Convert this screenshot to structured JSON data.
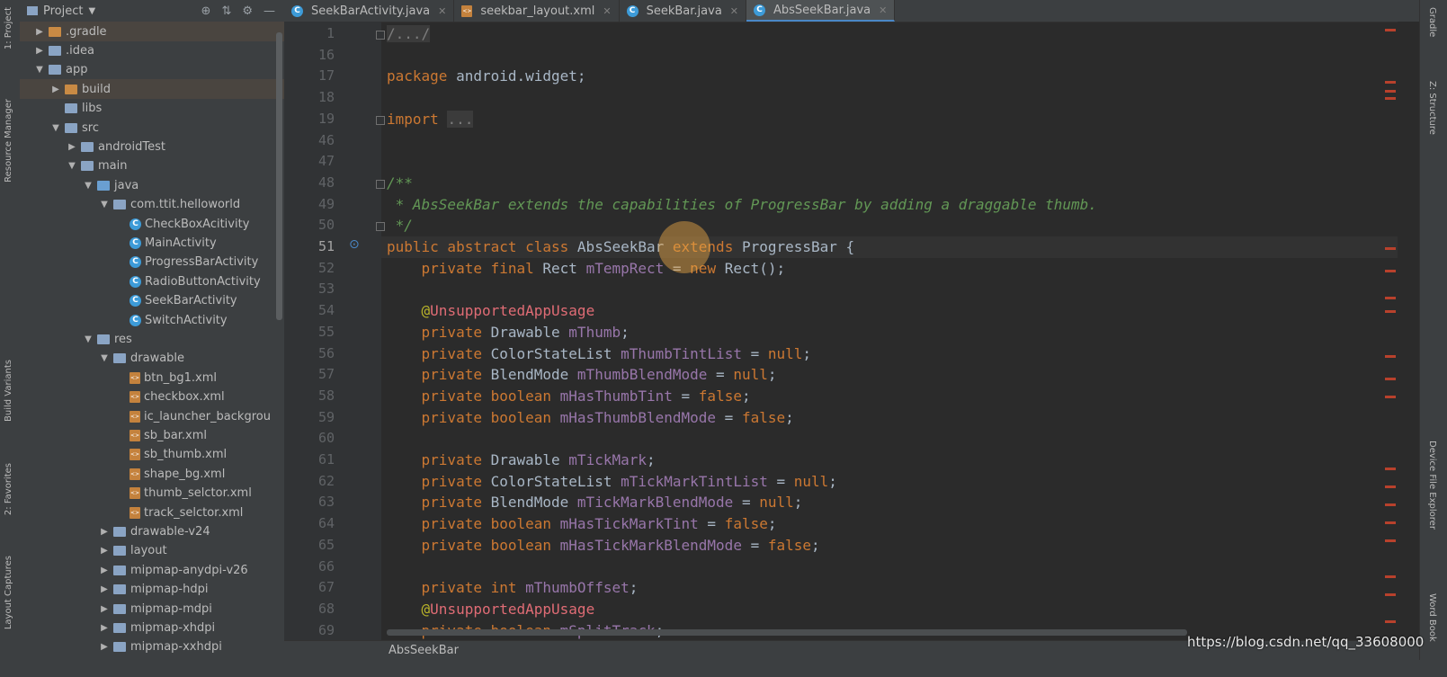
{
  "left_stripe": {
    "tabs": [
      "1: Project",
      "Resource Manager",
      "Build Variants",
      "2: Favorites",
      "Layout Captures"
    ]
  },
  "project_panel": {
    "title": "Project",
    "icons": [
      "target-icon",
      "collapse-icon",
      "gear-icon",
      "minimize-icon"
    ],
    "tree": [
      {
        "label": ".gradle",
        "depth": 1,
        "arrow": "▶",
        "icon": "folder-orange",
        "highlight": true
      },
      {
        "label": ".idea",
        "depth": 1,
        "arrow": "▶",
        "icon": "folder"
      },
      {
        "label": "app",
        "depth": 1,
        "arrow": "▼",
        "icon": "folder"
      },
      {
        "label": "build",
        "depth": 2,
        "arrow": "▶",
        "icon": "folder-orange",
        "highlight": true
      },
      {
        "label": "libs",
        "depth": 2,
        "arrow": "",
        "icon": "folder"
      },
      {
        "label": "src",
        "depth": 2,
        "arrow": "▼",
        "icon": "folder"
      },
      {
        "label": "androidTest",
        "depth": 3,
        "arrow": "▶",
        "icon": "folder"
      },
      {
        "label": "main",
        "depth": 3,
        "arrow": "▼",
        "icon": "folder"
      },
      {
        "label": "java",
        "depth": 4,
        "arrow": "▼",
        "icon": "folder-blue"
      },
      {
        "label": "com.ttit.helloworld",
        "depth": 5,
        "arrow": "▼",
        "icon": "folder"
      },
      {
        "label": "CheckBoxAcitivity",
        "depth": 6,
        "arrow": "",
        "icon": "class"
      },
      {
        "label": "MainActivity",
        "depth": 6,
        "arrow": "",
        "icon": "class"
      },
      {
        "label": "ProgressBarActivity",
        "depth": 6,
        "arrow": "",
        "icon": "class"
      },
      {
        "label": "RadioButtonActivity",
        "depth": 6,
        "arrow": "",
        "icon": "class"
      },
      {
        "label": "SeekBarActivity",
        "depth": 6,
        "arrow": "",
        "icon": "class"
      },
      {
        "label": "SwitchActivity",
        "depth": 6,
        "arrow": "",
        "icon": "class"
      },
      {
        "label": "res",
        "depth": 4,
        "arrow": "▼",
        "icon": "folder"
      },
      {
        "label": "drawable",
        "depth": 5,
        "arrow": "▼",
        "icon": "folder"
      },
      {
        "label": "btn_bg1.xml",
        "depth": 6,
        "arrow": "",
        "icon": "xml"
      },
      {
        "label": "checkbox.xml",
        "depth": 6,
        "arrow": "",
        "icon": "xml"
      },
      {
        "label": "ic_launcher_backgrou",
        "depth": 6,
        "arrow": "",
        "icon": "xml"
      },
      {
        "label": "sb_bar.xml",
        "depth": 6,
        "arrow": "",
        "icon": "xml"
      },
      {
        "label": "sb_thumb.xml",
        "depth": 6,
        "arrow": "",
        "icon": "xml"
      },
      {
        "label": "shape_bg.xml",
        "depth": 6,
        "arrow": "",
        "icon": "xml"
      },
      {
        "label": "thumb_selctor.xml",
        "depth": 6,
        "arrow": "",
        "icon": "xml"
      },
      {
        "label": "track_selctor.xml",
        "depth": 6,
        "arrow": "",
        "icon": "xml"
      },
      {
        "label": "drawable-v24",
        "depth": 5,
        "arrow": "▶",
        "icon": "folder"
      },
      {
        "label": "layout",
        "depth": 5,
        "arrow": "▶",
        "icon": "folder"
      },
      {
        "label": "mipmap-anydpi-v26",
        "depth": 5,
        "arrow": "▶",
        "icon": "folder"
      },
      {
        "label": "mipmap-hdpi",
        "depth": 5,
        "arrow": "▶",
        "icon": "folder"
      },
      {
        "label": "mipmap-mdpi",
        "depth": 5,
        "arrow": "▶",
        "icon": "folder"
      },
      {
        "label": "mipmap-xhdpi",
        "depth": 5,
        "arrow": "▶",
        "icon": "folder"
      },
      {
        "label": "mipmap-xxhdpi",
        "depth": 5,
        "arrow": "▶",
        "icon": "folder"
      }
    ]
  },
  "editor_tabs": [
    {
      "label": "SeekBarActivity.java",
      "icon": "class",
      "active": false
    },
    {
      "label": "seekbar_layout.xml",
      "icon": "xml",
      "active": false
    },
    {
      "label": "SeekBar.java",
      "icon": "class",
      "active": false
    },
    {
      "label": "AbsSeekBar.java",
      "icon": "class",
      "active": true
    }
  ],
  "editor": {
    "current_line": "51",
    "lines": [
      {
        "n": "1",
        "fold": true,
        "parts": [
          [
            "fold-text",
            "/.../"
          ]
        ]
      },
      {
        "n": "16",
        "parts": []
      },
      {
        "n": "17",
        "parts": [
          [
            "kw",
            "package "
          ],
          [
            "plain",
            "android.widget;"
          ]
        ]
      },
      {
        "n": "18",
        "parts": []
      },
      {
        "n": "19",
        "fold": true,
        "parts": [
          [
            "kw",
            "import "
          ],
          [
            "fold-text",
            "..."
          ]
        ]
      },
      {
        "n": "46",
        "parts": []
      },
      {
        "n": "47",
        "parts": []
      },
      {
        "n": "48",
        "fold": true,
        "parts": [
          [
            "cmt",
            "/**"
          ]
        ]
      },
      {
        "n": "49",
        "parts": [
          [
            "cmt",
            " * AbsSeekBar extends the capabilities of ProgressBar by adding a draggable thumb."
          ]
        ]
      },
      {
        "n": "50",
        "fold": true,
        "parts": [
          [
            "cmt",
            " */"
          ]
        ]
      },
      {
        "n": "51",
        "parts": [
          [
            "kw",
            "public abstract class "
          ],
          [
            "plain",
            "AbsSeekBar "
          ],
          [
            "kw",
            "extends "
          ],
          [
            "plain",
            "ProgressBar {"
          ]
        ]
      },
      {
        "n": "52",
        "parts": [
          [
            "kw",
            "    private final "
          ],
          [
            "plain",
            "Rect "
          ],
          [
            "fld",
            "mTempRect"
          ],
          [
            "plain",
            " = "
          ],
          [
            "kw",
            "new "
          ],
          [
            "plain",
            "Rect();"
          ]
        ]
      },
      {
        "n": "53",
        "parts": []
      },
      {
        "n": "54",
        "parts": [
          [
            "ann",
            "    @"
          ],
          [
            "annr",
            "UnsupportedAppUsage"
          ]
        ]
      },
      {
        "n": "55",
        "parts": [
          [
            "kw",
            "    private "
          ],
          [
            "plain",
            "Drawable "
          ],
          [
            "fld",
            "mThumb"
          ],
          [
            "plain",
            ";"
          ]
        ]
      },
      {
        "n": "56",
        "parts": [
          [
            "kw",
            "    private "
          ],
          [
            "plain",
            "ColorStateList "
          ],
          [
            "fld",
            "mThumbTintList"
          ],
          [
            "plain",
            " = "
          ],
          [
            "kw",
            "null"
          ],
          [
            "plain",
            ";"
          ]
        ]
      },
      {
        "n": "57",
        "parts": [
          [
            "kw",
            "    private "
          ],
          [
            "plain",
            "BlendMode "
          ],
          [
            "fld",
            "mThumbBlendMode"
          ],
          [
            "plain",
            " = "
          ],
          [
            "kw",
            "null"
          ],
          [
            "plain",
            ";"
          ]
        ]
      },
      {
        "n": "58",
        "parts": [
          [
            "kw",
            "    private boolean "
          ],
          [
            "fld",
            "mHasThumbTint"
          ],
          [
            "plain",
            " = "
          ],
          [
            "kw",
            "false"
          ],
          [
            "plain",
            ";"
          ]
        ]
      },
      {
        "n": "59",
        "parts": [
          [
            "kw",
            "    private boolean "
          ],
          [
            "fld",
            "mHasThumbBlendMode"
          ],
          [
            "plain",
            " = "
          ],
          [
            "kw",
            "false"
          ],
          [
            "plain",
            ";"
          ]
        ]
      },
      {
        "n": "60",
        "parts": []
      },
      {
        "n": "61",
        "parts": [
          [
            "kw",
            "    private "
          ],
          [
            "plain",
            "Drawable "
          ],
          [
            "fld",
            "mTickMark"
          ],
          [
            "plain",
            ";"
          ]
        ]
      },
      {
        "n": "62",
        "parts": [
          [
            "kw",
            "    private "
          ],
          [
            "plain",
            "ColorStateList "
          ],
          [
            "fld",
            "mTickMarkTintList"
          ],
          [
            "plain",
            " = "
          ],
          [
            "kw",
            "null"
          ],
          [
            "plain",
            ";"
          ]
        ]
      },
      {
        "n": "63",
        "parts": [
          [
            "kw",
            "    private "
          ],
          [
            "plain",
            "BlendMode "
          ],
          [
            "fld",
            "mTickMarkBlendMode"
          ],
          [
            "plain",
            " = "
          ],
          [
            "kw",
            "null"
          ],
          [
            "plain",
            ";"
          ]
        ]
      },
      {
        "n": "64",
        "parts": [
          [
            "kw",
            "    private boolean "
          ],
          [
            "fld",
            "mHasTickMarkTint"
          ],
          [
            "plain",
            " = "
          ],
          [
            "kw",
            "false"
          ],
          [
            "plain",
            ";"
          ]
        ]
      },
      {
        "n": "65",
        "parts": [
          [
            "kw",
            "    private boolean "
          ],
          [
            "fld",
            "mHasTickMarkBlendMode"
          ],
          [
            "plain",
            " = "
          ],
          [
            "kw",
            "false"
          ],
          [
            "plain",
            ";"
          ]
        ]
      },
      {
        "n": "66",
        "parts": []
      },
      {
        "n": "67",
        "parts": [
          [
            "kw",
            "    private int "
          ],
          [
            "fld",
            "mThumbOffset"
          ],
          [
            "plain",
            ";"
          ]
        ]
      },
      {
        "n": "68",
        "parts": [
          [
            "ann",
            "    @"
          ],
          [
            "annr",
            "UnsupportedAppUsage"
          ]
        ]
      },
      {
        "n": "69",
        "parts": [
          [
            "kw",
            "    private boolean "
          ],
          [
            "fld",
            "mSplitTrack"
          ],
          [
            "plain",
            ";"
          ]
        ]
      }
    ]
  },
  "right_stripe": {
    "tabs": [
      "Gradle",
      "Z: Structure",
      "Device File Explorer",
      "Word Book"
    ]
  },
  "breadcrumb": "AbsSeekBar",
  "watermark": "https://blog.csdn.net/qq_33608000",
  "colors": {
    "keyword": "#cc7832",
    "field": "#9876aa",
    "comment": "#629755",
    "annotation": "#bbb529",
    "background": "#2b2b2b"
  }
}
